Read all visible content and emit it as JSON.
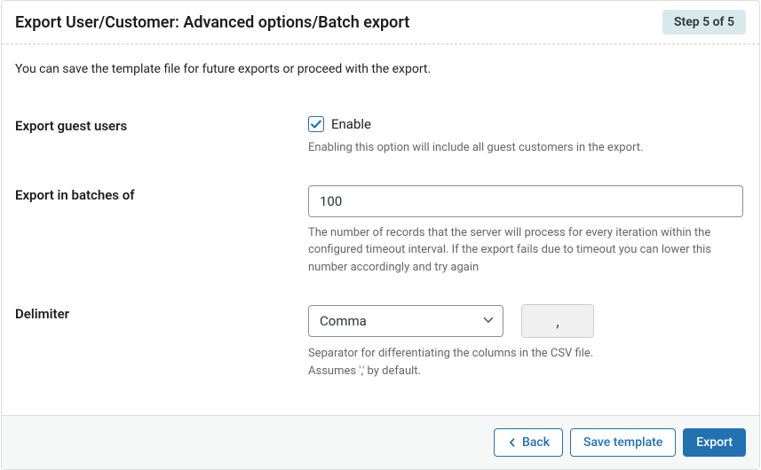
{
  "header": {
    "title": "Export User/Customer: Advanced options/Batch export",
    "step_badge": "Step 5 of 5"
  },
  "intro": "You can save the template file for future exports or proceed with the export.",
  "fields": {
    "guest": {
      "label": "Export guest users",
      "checkbox_label": "Enable",
      "checked": true,
      "helper": "Enabling this option will include all guest customers in the export."
    },
    "batch": {
      "label": "Export in batches of",
      "value": "100",
      "helper": "The number of records that the server will process for every iteration within the configured timeout interval. If the export fails due to timeout you can lower this number accordingly and try again"
    },
    "delimiter": {
      "label": "Delimiter",
      "selected": "Comma",
      "char": ",",
      "helper": "Separator for differentiating the columns in the CSV file. Assumes ',' by default."
    }
  },
  "footer": {
    "back": "Back",
    "save_template": "Save template",
    "export": "Export"
  }
}
